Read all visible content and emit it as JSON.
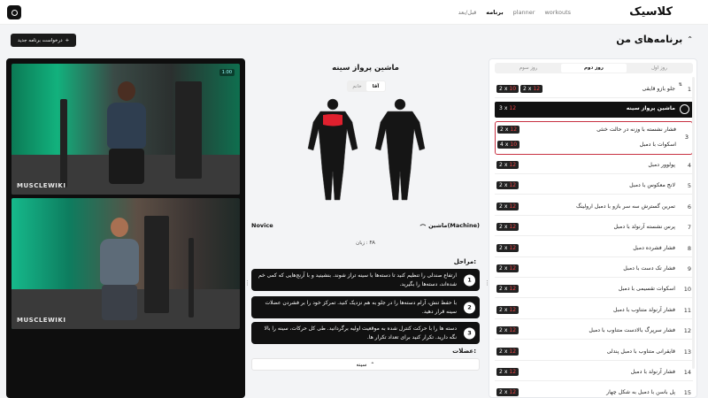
{
  "nav": {
    "brand": "کلاسیک",
    "links": [
      "workouts",
      "planner",
      "برنامه",
      "قبل/بعد"
    ],
    "active_index": 2
  },
  "programs": {
    "title": "برنامه‌های من",
    "new_button": "درخواست برنامه جدید"
  },
  "videos": {
    "watermark": "MUSCLEWIKI",
    "time_badge": "1:00"
  },
  "exercise": {
    "title": "ماشین پرواز سینه",
    "gender_tabs": [
      "آقا",
      "خانم"
    ],
    "gender_active": 0,
    "equipment": "ماشین(Machine)",
    "level": "Novice",
    "language": "زبان : FA",
    "steps_heading": "مراحل:",
    "steps": [
      "ارتفاع صندلی را تنظیم کنید تا دسته‌ها با سینه تراز شوند. بنشینید و با آرنج‌هایی که کمی خم شده‌اند، دسته‌ها را بگیرید.",
      "با حفظ تنش، آرام دسته‌ها را در جلو به هم نزدیک کنید. تمرکز خود را بر فشردن عضلات سینه قرار دهید.",
      "دسته ها را با حرکت کنترل شده به موقعیت اولیه برگردانید. طی کل حرکات، سینه را بالا نگه دارید. تکرار کنید برای تعداد تکرار ها."
    ],
    "muscles_heading": "عضلات:",
    "muscle_selected": "سینه",
    "highlight_color": "#e0202e"
  },
  "days": {
    "tabs": [
      "روز اول",
      "روز دوم",
      "روز سوم"
    ],
    "active_index": 1
  },
  "workout": [
    {
      "idx": "1",
      "name": "جلو بازو قایقی",
      "sets": [
        [
          "2",
          "10"
        ],
        [
          "2",
          "12"
        ]
      ]
    },
    {
      "idx": "",
      "name": "ماشین پرواز سینه",
      "sets": [
        [
          "3",
          "12"
        ]
      ],
      "active": true
    },
    {
      "idx": "3",
      "group": [
        {
          "name": "فشار نشسته با وزنه در حالت خنثی",
          "sets": [
            [
              "2",
              "12"
            ]
          ]
        },
        {
          "name": "اسکوات با دمبل",
          "sets": [
            [
              "4",
              "10"
            ]
          ]
        }
      ]
    },
    {
      "idx": "4",
      "name": "پولوور دمبل",
      "sets": [
        [
          "2",
          "12"
        ]
      ]
    },
    {
      "idx": "5",
      "name": "لانج معکوس با دمبل",
      "sets": [
        [
          "2",
          "12"
        ]
      ]
    },
    {
      "idx": "6",
      "name": "تمرین گسترش سه سر بازو با دمبل ارولینگ",
      "sets": [
        [
          "2",
          "12"
        ]
      ]
    },
    {
      "idx": "7",
      "name": "پرس نشسته آرنولد با دمبل",
      "sets": [
        [
          "2",
          "12"
        ]
      ]
    },
    {
      "idx": "8",
      "name": "فشار فشرده دمبل",
      "sets": [
        [
          "2",
          "12"
        ]
      ]
    },
    {
      "idx": "9",
      "name": "فشار تک دست با دمبل",
      "sets": [
        [
          "2",
          "12"
        ]
      ]
    },
    {
      "idx": "10",
      "name": "اسکوات تقسیمی با دمبل",
      "sets": [
        [
          "2",
          "12"
        ]
      ]
    },
    {
      "idx": "11",
      "name": "فشار آرنولد متناوب با دمبل",
      "sets": [
        [
          "2",
          "12"
        ]
      ]
    },
    {
      "idx": "12",
      "name": "فشار سرپرگ بالادست متناوب با دمبل",
      "sets": [
        [
          "2",
          "12"
        ]
      ]
    },
    {
      "idx": "13",
      "name": "قایقرانی متناوب با دمبل پندلی",
      "sets": [
        [
          "2",
          "12"
        ]
      ]
    },
    {
      "idx": "14",
      "name": "فشار آرنولد با دمبل",
      "sets": [
        [
          "2",
          "12"
        ]
      ]
    },
    {
      "idx": "15",
      "name": "پل باسن با دمبل به شکل چهار",
      "sets": [
        [
          "2",
          "12"
        ]
      ]
    }
  ]
}
